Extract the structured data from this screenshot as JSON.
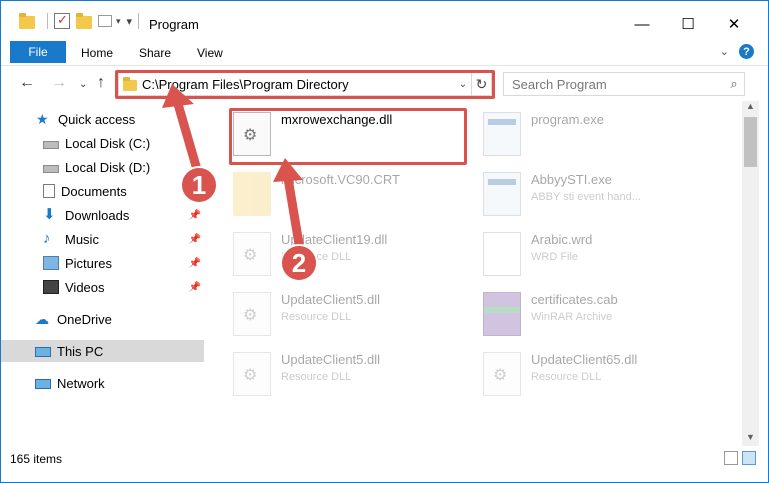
{
  "title": "Program",
  "ribbon": {
    "file": "File",
    "tabs": [
      "Home",
      "Share",
      "View"
    ],
    "help_glyph": "?"
  },
  "address": {
    "path": "C:\\Program Files\\Program Directory",
    "search_placeholder": "Search Program"
  },
  "sidebar": {
    "items": [
      {
        "label": "Quick access",
        "icon": "star-icon",
        "pinned": false
      },
      {
        "label": "Local Disk (C:)",
        "icon": "disk-icon",
        "pinned": false
      },
      {
        "label": "Local Disk (D:)",
        "icon": "disk-icon",
        "pinned": false
      },
      {
        "label": "Documents",
        "icon": "documents-icon",
        "pinned": false
      },
      {
        "label": "Downloads",
        "icon": "downloads-icon",
        "pinned": true
      },
      {
        "label": "Music",
        "icon": "music-icon",
        "pinned": true
      },
      {
        "label": "Pictures",
        "icon": "pictures-icon",
        "pinned": true
      },
      {
        "label": "Videos",
        "icon": "videos-icon",
        "pinned": true
      },
      {
        "label": "OneDrive",
        "icon": "cloud-icon",
        "pinned": false
      },
      {
        "label": "This PC",
        "icon": "pc-icon",
        "pinned": false,
        "selected": true
      },
      {
        "label": "Network",
        "icon": "network-icon",
        "pinned": false
      }
    ]
  },
  "files": [
    {
      "name": "mxrowexchange.dll",
      "type": "",
      "icon": "dll-icon",
      "highlighted": true
    },
    {
      "name": "program.exe",
      "type": "",
      "icon": "exe-icon"
    },
    {
      "name": "Microsoft.VC90.CRT",
      "type": "",
      "icon": "folder-icon"
    },
    {
      "name": "AbbyySTI.exe",
      "type": "ABBY sti event hand...",
      "icon": "exe-icon"
    },
    {
      "name": "UpdateClient19.dll",
      "type": "Resource DLL",
      "icon": "dll-icon"
    },
    {
      "name": "Arabic.wrd",
      "type": "WRD File",
      "icon": "wrd-icon"
    },
    {
      "name": "UpdateClient5.dll",
      "type": "Resource DLL",
      "icon": "dll-icon"
    },
    {
      "name": "certificates.cab",
      "type": "WinRAR Archive",
      "icon": "cab-icon"
    },
    {
      "name": "UpdateClient5.dll",
      "type": "Resource DLL",
      "icon": "dll-icon"
    },
    {
      "name": "UpdateClient65.dll",
      "type": "Resource DLL",
      "icon": "dll-icon"
    }
  ],
  "status": {
    "count": "165 items"
  },
  "annotations": {
    "step1": "1",
    "step2": "2",
    "color": "#d9534f"
  }
}
